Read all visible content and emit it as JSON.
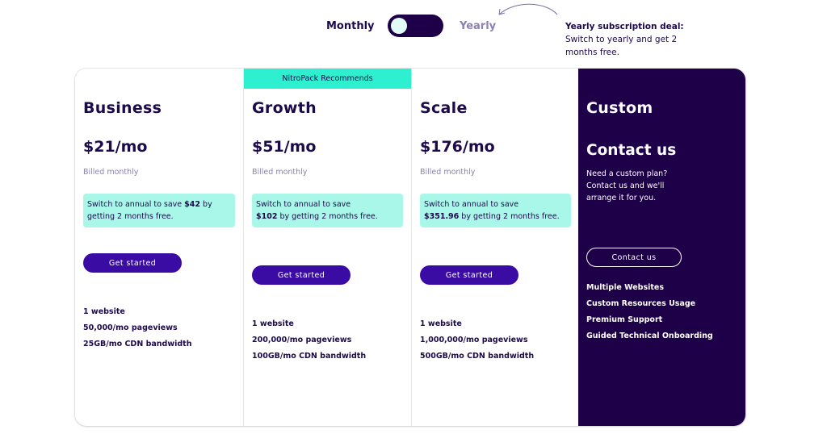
{
  "billing_toggle": {
    "monthly_label": "Monthly",
    "yearly_label": "Yearly",
    "selected": "Monthly"
  },
  "deal": {
    "title": "Yearly subscription deal:",
    "text": "Switch to yearly and get 2 months free."
  },
  "colors": {
    "dark_purple": "#1d0048",
    "button_purple": "#3a0ca3",
    "teal_banner": "#2ef0d0",
    "savings_bg": "#a9f7e9",
    "muted_text": "#8d80b3"
  },
  "plans": [
    {
      "name": "Business",
      "price": "$21/mo",
      "billing": "Billed monthly",
      "savings_prefix": "Switch to annual to save ",
      "savings_amount": "$42",
      "savings_suffix": " by getting 2 months free.",
      "cta": "Get started",
      "features": [
        "1 website",
        "50,000/mo pageviews",
        "25GB/mo CDN bandwidth"
      ]
    },
    {
      "name": "Growth",
      "badge": "NitroPack Recommends",
      "price": "$51/mo",
      "billing": "Billed monthly",
      "savings_prefix": "Switch to annual to save ",
      "savings_amount": "$102",
      "savings_suffix": " by getting 2 months free.",
      "cta": "Get started",
      "features": [
        "1 website",
        "200,000/mo pageviews",
        "100GB/mo CDN bandwidth"
      ]
    },
    {
      "name": "Scale",
      "price": "$176/mo",
      "billing": "Billed monthly",
      "savings_prefix": "Switch to annual to save ",
      "savings_amount": "$351.96",
      "savings_suffix": " by getting 2 months free.",
      "cta": "Get started",
      "features": [
        "1 website",
        "1,000,000/mo pageviews",
        "500GB/mo CDN bandwidth"
      ]
    },
    {
      "name": "Custom",
      "heading": "Contact us",
      "description": "Need a custom plan? Contact us and we'll arrange it for you.",
      "cta": "Contact us",
      "features": [
        "Multiple Websites",
        "Custom Resources Usage",
        "Premium Support",
        "Guided Technical Onboarding"
      ]
    }
  ]
}
